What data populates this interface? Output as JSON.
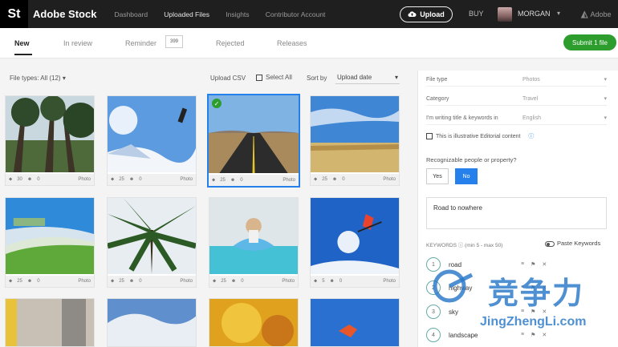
{
  "topbar": {
    "logo": "St",
    "brand": "Adobe Stock",
    "nav": [
      "Dashboard",
      "Uploaded Files",
      "Insights",
      "Contributor Account"
    ],
    "upload_label": "Upload",
    "buy_label": "BUY",
    "user_name": "MORGAN",
    "adobe_label": "Adobe"
  },
  "tabs": {
    "items": [
      "New",
      "In review",
      "Reminder",
      "Rejected",
      "Releases"
    ],
    "reminder_count": "399",
    "submit_label": "Submit 1 file"
  },
  "filters": {
    "file_types": "File types: All (12)",
    "upload_csv": "Upload CSV",
    "select_all": "Select All",
    "sort_by": "Sort by",
    "sort_value": "Upload date"
  },
  "thumbs": [
    {
      "kw": "30",
      "people": "0",
      "type": "Photo"
    },
    {
      "kw": "25",
      "people": "0",
      "type": "Photo"
    },
    {
      "kw": "25",
      "people": "0",
      "type": "Photo"
    },
    {
      "kw": "25",
      "people": "0",
      "type": "Photo"
    },
    {
      "kw": "25",
      "people": "0",
      "type": "Photo"
    },
    {
      "kw": "25",
      "people": "0",
      "type": "Photo"
    },
    {
      "kw": "25",
      "people": "0",
      "type": "Photo"
    },
    {
      "kw": "5",
      "people": "0",
      "type": "Photo"
    }
  ],
  "panel": {
    "file_type_label": "File type",
    "file_type_value": "Photos",
    "category_label": "Category",
    "category_value": "Travel",
    "language_label": "I'm writing title & keywords in",
    "language_value": "English",
    "editorial_label": "This is illustrative Editorial content",
    "people_question": "Recognizable people or property?",
    "yes": "Yes",
    "no": "No",
    "title_value": "Road to nowhere",
    "keywords_label": "KEYWORDS",
    "keywords_hint": "(min 5 - max 50)",
    "paste_label": "Paste Keywords",
    "keywords": [
      {
        "n": "1",
        "text": "road"
      },
      {
        "n": "2",
        "text": "highway"
      },
      {
        "n": "3",
        "text": "sky"
      },
      {
        "n": "4",
        "text": "landscape"
      }
    ]
  },
  "watermark": {
    "cn": "竞争力",
    "en": "JingZhengLi.com"
  }
}
